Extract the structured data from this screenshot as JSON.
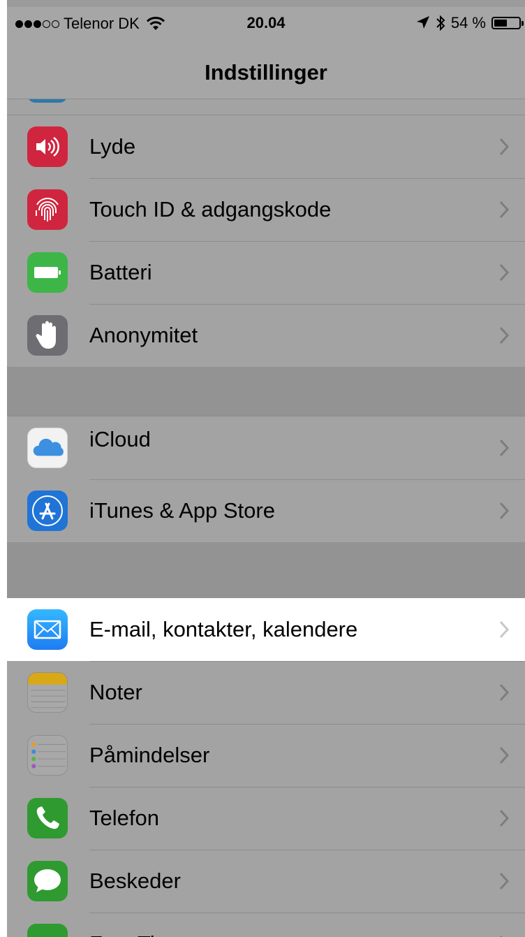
{
  "status_bar": {
    "signal_dots": [
      true,
      true,
      true,
      false,
      false
    ],
    "carrier": "Telenor DK",
    "time": "20.04",
    "battery_text": "54 %",
    "battery_percent": 54
  },
  "nav": {
    "title": "Indstillinger"
  },
  "groups": [
    {
      "items": [
        {
          "label": "Lyde",
          "icon": "speaker-icon",
          "color": "#d0253f"
        },
        {
          "label": "Touch ID & adgangskode",
          "icon": "fingerprint-icon",
          "color": "#d0253f"
        },
        {
          "label": "Batteri",
          "icon": "battery-icon",
          "color": "#3db547"
        },
        {
          "label": "Anonymitet",
          "icon": "hand-icon",
          "color": "#6d6d72"
        }
      ]
    },
    {
      "items": [
        {
          "label": "iCloud",
          "icon": "icloud-icon",
          "color": "#f2f2f2"
        },
        {
          "label": "iTunes & App Store",
          "icon": "app-store-icon",
          "color": "#1f74d6"
        }
      ]
    },
    {
      "items": [
        {
          "label": "E-mail, kontakter, kalendere",
          "icon": "mail-icon",
          "color": "#2aa5f5",
          "highlighted": true
        },
        {
          "label": "Noter",
          "icon": "notes-icon",
          "color": "#f7c31f"
        },
        {
          "label": "Påmindelser",
          "icon": "reminders-icon",
          "color": "#ffffff"
        },
        {
          "label": "Telefon",
          "icon": "phone-icon",
          "color": "#3cc43c"
        },
        {
          "label": "Beskeder",
          "icon": "messages-icon",
          "color": "#3cc43c"
        },
        {
          "label": "FaceTime",
          "icon": "facetime-icon",
          "color": "#3cc43c"
        }
      ]
    }
  ]
}
